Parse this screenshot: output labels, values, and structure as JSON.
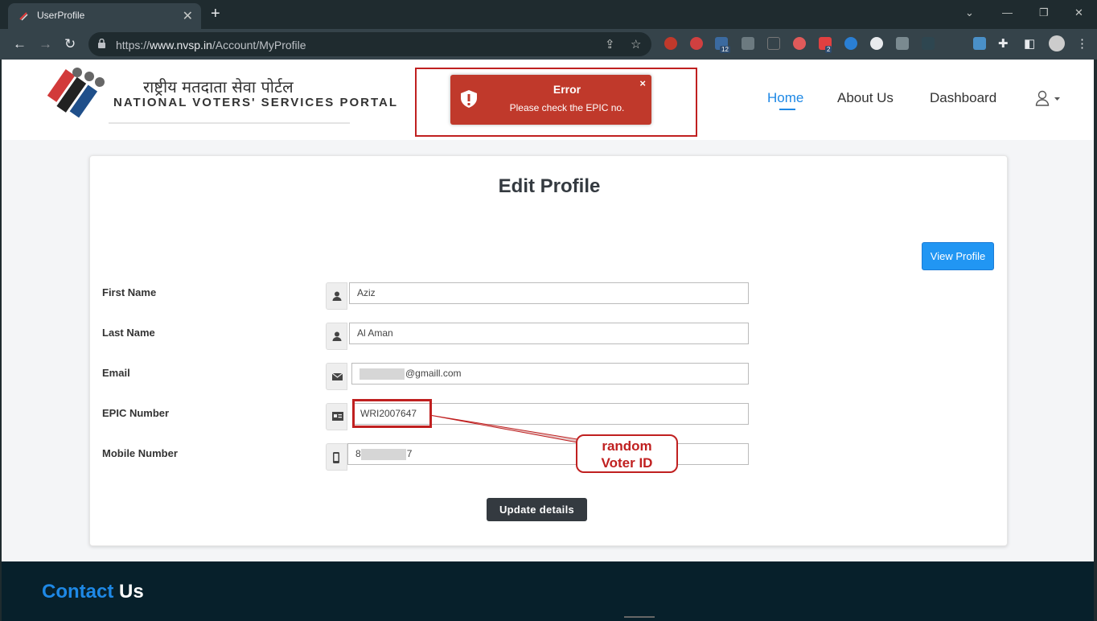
{
  "browser": {
    "tab_title": "UserProfile",
    "url_prefix": "https://",
    "url_host": "www.nvsp.in",
    "url_path": "/Account/MyProfile",
    "ext_badges": [
      "12",
      "2"
    ]
  },
  "site": {
    "logo_hindi": "राष्ट्रीय मतदाता सेवा पोर्टल",
    "logo_english": "NATIONAL VOTERS' SERVICES PORTAL",
    "nav": [
      "Home",
      "About Us",
      "Dashboard"
    ],
    "accent_color": "#1e88e5"
  },
  "toast": {
    "title": "Error",
    "message": "Please check the EPIC no.",
    "close": "×",
    "color": "#c0392b"
  },
  "card": {
    "title": "Edit Profile",
    "view_button": "View Profile",
    "update_button": "Update details",
    "fields": {
      "first_name": {
        "label": "First Name",
        "value": "Aziz"
      },
      "last_name": {
        "label": "Last Name",
        "value": "Al Aman"
      },
      "email": {
        "label": "Email",
        "value": "@gmaill.com"
      },
      "epic": {
        "label": "EPIC Number",
        "value": "WRI2007647"
      },
      "mobile": {
        "label": "Mobile Number",
        "prefix": "8",
        "suffix": "7"
      }
    }
  },
  "annotation": {
    "line1": "random",
    "line2": "Voter ID"
  },
  "footer": {
    "contact_accent": "Contact",
    "contact_rest": " Us"
  }
}
